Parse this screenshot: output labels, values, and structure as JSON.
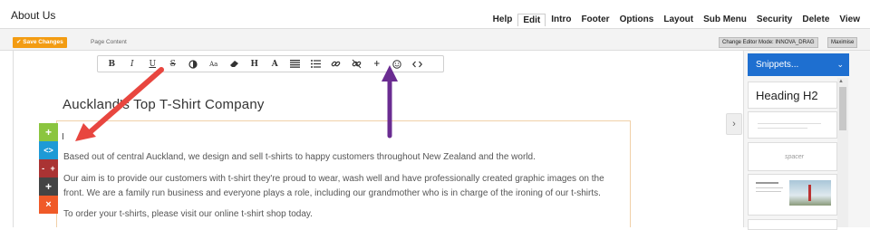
{
  "page": {
    "title": "About Us"
  },
  "tabs": [
    {
      "label": "Help"
    },
    {
      "label": "Edit"
    },
    {
      "label": "Intro"
    },
    {
      "label": "Footer"
    },
    {
      "label": "Options"
    },
    {
      "label": "Layout"
    },
    {
      "label": "Sub Menu"
    },
    {
      "label": "Security"
    },
    {
      "label": "Delete"
    },
    {
      "label": "View"
    }
  ],
  "subbar": {
    "save_label": "Save Changes",
    "page_content_label": "Page Content",
    "mode_label": "Change Editor Mode: INNOVA_DRAG",
    "maximise_label": "Maximise"
  },
  "toolbar": {
    "bold": "B",
    "italic": "I",
    "underline": "U",
    "strike": "S",
    "font_size": "Aa",
    "heading": "H",
    "font": "A",
    "insert": "+"
  },
  "content": {
    "heading": "Auckland's Top T-Shirt Company",
    "p1": "Based out of central Auckland, we design and sell t-shirts to happy customers throughout New Zealand and the world.",
    "p2": "Our aim is to provide our customers with t-shirt they're proud to wear, wash well and have professionally created graphic images on the front. We are a family run business and everyone plays a role, including our grandmother who is in charge of the ironing of our t-shirts.",
    "p3": "To order your t-shirts, please visit our online t-shirt shop today."
  },
  "side_tools": {
    "move": "+",
    "code": "<>",
    "size_minus": "-",
    "size_plus": "+",
    "add": "+",
    "delete": "×"
  },
  "snippets": {
    "select_label": "Snippets...",
    "heading_label": "Heading H2",
    "spacer_label": "spacer"
  },
  "colors": {
    "accent_orange": "#f39c12",
    "snippets_blue": "#1e6fd0",
    "arrow_red": "#e8463f",
    "arrow_purple": "#6a2c91"
  }
}
